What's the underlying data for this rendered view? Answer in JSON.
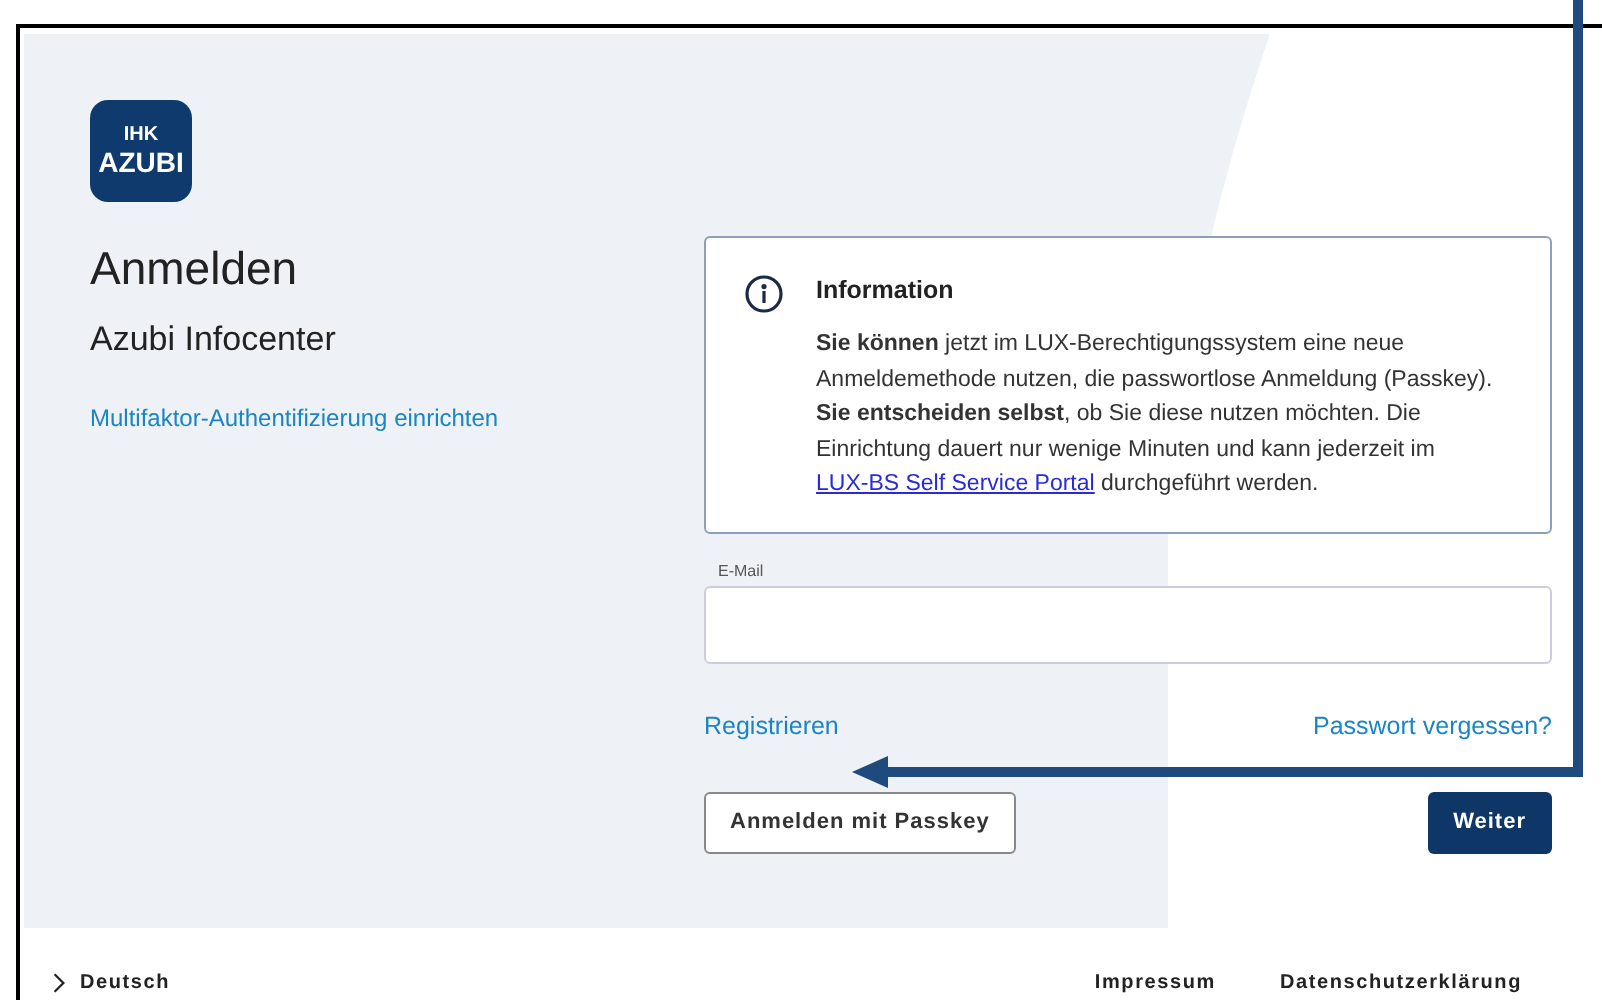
{
  "logo": {
    "line1": "IHK",
    "line2": "AZUBI"
  },
  "heading": "Anmelden",
  "subheading": "Azubi Infocenter",
  "mfa_link": "Multifaktor-Authentifizierung einrichten",
  "info": {
    "title": "Information",
    "text": "**Sie können** jetzt im LUX-Berechtigungssystem eine neue Anmeldemethode nutzen, die passwortlose Anmeldung (Passkey). **Sie entscheiden selbst**, ob Sie diese nutzen möchten. Die Einrichtung dauert nur wenige Minuten und kann jederzeit im",
    "link": "LUX-BS Self Service Portal",
    "text_after": "durchgeführt werden."
  },
  "email": {
    "label": "E-Mail"
  },
  "register_link": "Registrieren",
  "forgot_link": "Passwort vergessen?",
  "passkey_button": "Anmelden mit Passkey",
  "next_button": "Weiter",
  "footer": {
    "language": "Deutsch",
    "links": [
      "Impressum",
      "Datenschutzerklärung"
    ]
  }
}
